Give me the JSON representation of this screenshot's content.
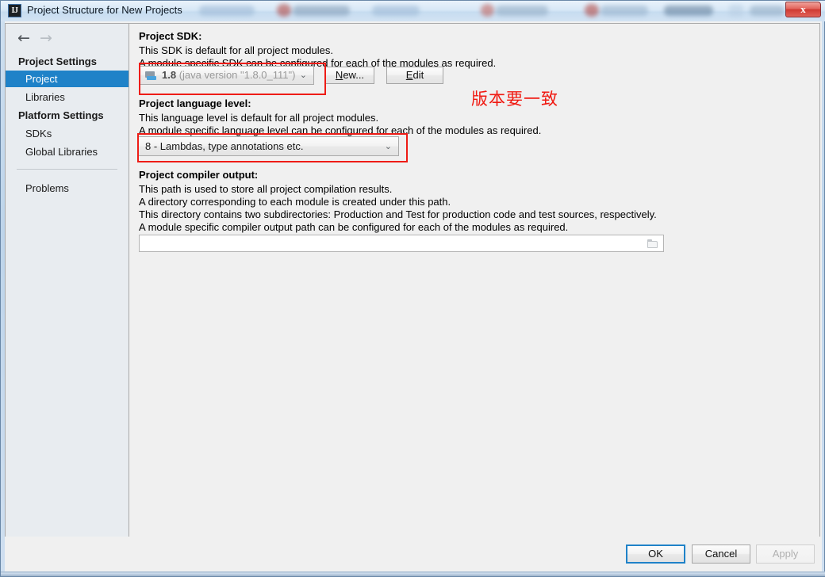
{
  "window": {
    "title": "Project Structure for New Projects",
    "app_icon": "IJ",
    "close_label": "x"
  },
  "sidebar": {
    "back_icon": "←",
    "forward_icon": "→",
    "groups": [
      {
        "label": "Project Settings"
      },
      {
        "label": "Platform Settings"
      }
    ],
    "items": [
      {
        "label": "Project",
        "selected": true
      },
      {
        "label": "Libraries",
        "selected": false
      },
      {
        "label": "SDKs",
        "selected": false
      },
      {
        "label": "Global Libraries",
        "selected": false
      },
      {
        "label": "Problems",
        "selected": false
      }
    ]
  },
  "main": {
    "sdk": {
      "title": "Project SDK:",
      "line1": "This SDK is default for all project modules.",
      "line2": "A module specific SDK can be configured for each of the modules as required.",
      "combo_version": "1.8",
      "combo_detail": "(java version \"1.8.0_111\")",
      "chevron": "⌄",
      "new_button": {
        "prefix": "",
        "mnemonic": "N",
        "suffix": "ew..."
      },
      "edit_button": {
        "prefix": "",
        "mnemonic": "E",
        "suffix": "dit"
      }
    },
    "language_level": {
      "title": "Project language level:",
      "line1": "This language level is default for all project modules.",
      "line2": "A module specific language level can be configured for each of the modules as required.",
      "combo_value": "8 - Lambdas, type annotations etc.",
      "chevron": "⌄"
    },
    "compiler_output": {
      "title": "Project compiler output:",
      "line1": "This path is used to store all project compilation results.",
      "line2": "A directory corresponding to each module is created under this path.",
      "line3": "This directory contains two subdirectories: Production and Test for production code and test sources, respectively.",
      "line4": "A module specific compiler output path can be configured for each of the modules as required.",
      "field_value": "",
      "field_placeholder": ""
    }
  },
  "annotations": {
    "note_text": "版本要一致",
    "color": "#ee1c16"
  },
  "footer": {
    "ok_label": "OK",
    "cancel_label": "Cancel",
    "apply_label": "Apply"
  }
}
